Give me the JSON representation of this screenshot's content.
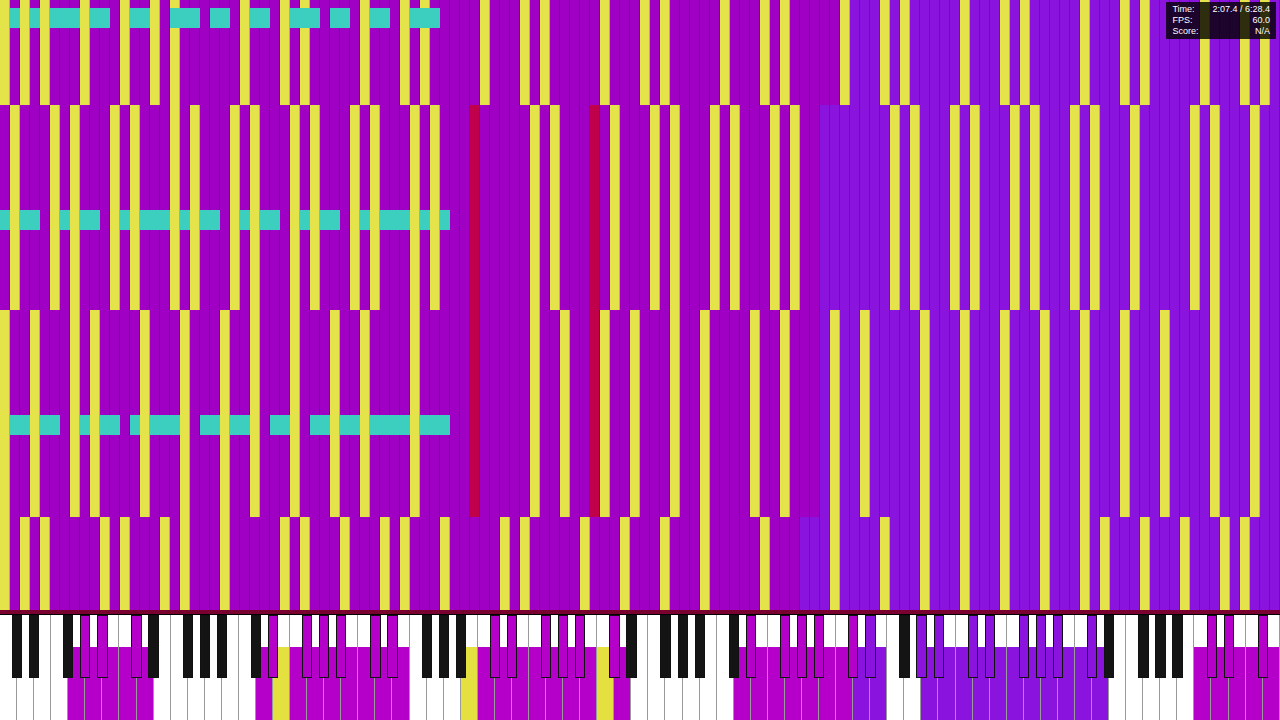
{
  "hud": {
    "time_label": "Time:",
    "time": "2:07.4 / 6:28.4",
    "fps_label": "FPS:",
    "fps": "60.0",
    "score_label": "Score:",
    "score": "N/A"
  },
  "waterfall": {
    "bands": [
      {
        "fills": [
          {
            "from": 0,
            "to": 83,
            "color": "#a000c4"
          },
          {
            "from": 84,
            "to": 127,
            "color": "#8a14de"
          }
        ],
        "accent_color": "#e4e44a",
        "accents": [
          0,
          2,
          4,
          8,
          12,
          15,
          17,
          24,
          28,
          30,
          36,
          40,
          42,
          48,
          52,
          54,
          60,
          64,
          66,
          72,
          76,
          78,
          84,
          88,
          90,
          96,
          100,
          102,
          108,
          112,
          114,
          120,
          124,
          126
        ],
        "marks": [],
        "mark_color": "#c0004a",
        "cyan_color": "#3ccfc0",
        "cyan_keys": [
          1,
          3,
          5,
          6,
          7,
          9,
          10,
          13,
          14,
          17,
          18,
          19,
          21,
          22,
          25,
          26,
          29,
          30,
          31,
          33,
          34,
          37,
          38,
          41,
          42,
          43
        ]
      },
      {
        "fills": [
          {
            "from": 0,
            "to": 81,
            "color": "#a000c4"
          },
          {
            "from": 82,
            "to": 127,
            "color": "#8a14de"
          }
        ],
        "accent_color": "#e4e44a",
        "accents": [
          1,
          5,
          7,
          11,
          13,
          17,
          19,
          23,
          25,
          29,
          31,
          35,
          37,
          41,
          43,
          53,
          55,
          61,
          65,
          67,
          71,
          73,
          77,
          79,
          89,
          91,
          95,
          97,
          101,
          103,
          107,
          109,
          113,
          119,
          121,
          125
        ],
        "marks": [
          47,
          59
        ],
        "mark_color": "#c0004a",
        "cyan_color": "#3ccfc0",
        "cyan_keys": [
          0,
          2,
          3,
          6,
          8,
          9,
          12,
          14,
          15,
          16,
          18,
          20,
          21,
          24,
          26,
          27,
          30,
          32,
          33,
          36,
          38,
          39,
          40,
          42,
          44
        ]
      },
      {
        "fills": [
          {
            "from": 0,
            "to": 81,
            "color": "#a000c4"
          },
          {
            "from": 82,
            "to": 127,
            "color": "#8a14de"
          }
        ],
        "accent_color": "#e4e44a",
        "accents": [
          0,
          3,
          7,
          9,
          14,
          18,
          22,
          25,
          29,
          33,
          36,
          41,
          53,
          56,
          60,
          63,
          67,
          70,
          75,
          78,
          83,
          86,
          92,
          96,
          100,
          104,
          108,
          112,
          116,
          121,
          125
        ],
        "marks": [
          47,
          59
        ],
        "mark_color": "#c0004a",
        "cyan_color": "#3ccfc0",
        "cyan_keys": [
          1,
          2,
          4,
          5,
          8,
          10,
          11,
          13,
          15,
          16,
          17,
          20,
          21,
          23,
          24,
          27,
          28,
          31,
          32,
          34,
          35,
          37,
          38,
          39,
          40,
          42,
          43,
          44
        ]
      },
      {
        "fills": [
          {
            "from": 0,
            "to": 79,
            "color": "#a000c4"
          },
          {
            "from": 80,
            "to": 127,
            "color": "#8a14de"
          }
        ],
        "accent_color": "#e4e44a",
        "accents": [
          0,
          2,
          4,
          10,
          12,
          16,
          18,
          22,
          28,
          30,
          34,
          38,
          40,
          44,
          50,
          52,
          58,
          62,
          66,
          70,
          76,
          83,
          88,
          92,
          96,
          100,
          104,
          108,
          110,
          114,
          118,
          122,
          124
        ],
        "marks": [],
        "mark_color": "#c0004a",
        "cyan_color": "#3ccfc0",
        "cyan_keys": []
      }
    ]
  },
  "keyboard": {
    "key_count": 128,
    "pressed": [
      {
        "from": 7,
        "to": 14,
        "color": "#b400c8"
      },
      {
        "from": 26,
        "to": 40,
        "color": "#b400c8"
      },
      {
        "from": 28,
        "to": 28,
        "color": "#e4e040"
      },
      {
        "from": 48,
        "to": 62,
        "color": "#b400c8"
      },
      {
        "from": 47,
        "to": 47,
        "color": "#e4e040"
      },
      {
        "from": 60,
        "to": 60,
        "color": "#e4e040"
      },
      {
        "from": 74,
        "to": 88,
        "color": "#b400c8"
      },
      {
        "from": 86,
        "to": 88,
        "color": "#8a14de"
      },
      {
        "from": 92,
        "to": 110,
        "color": "#8a14de"
      },
      {
        "from": 120,
        "to": 127,
        "color": "#b400c8"
      }
    ]
  }
}
